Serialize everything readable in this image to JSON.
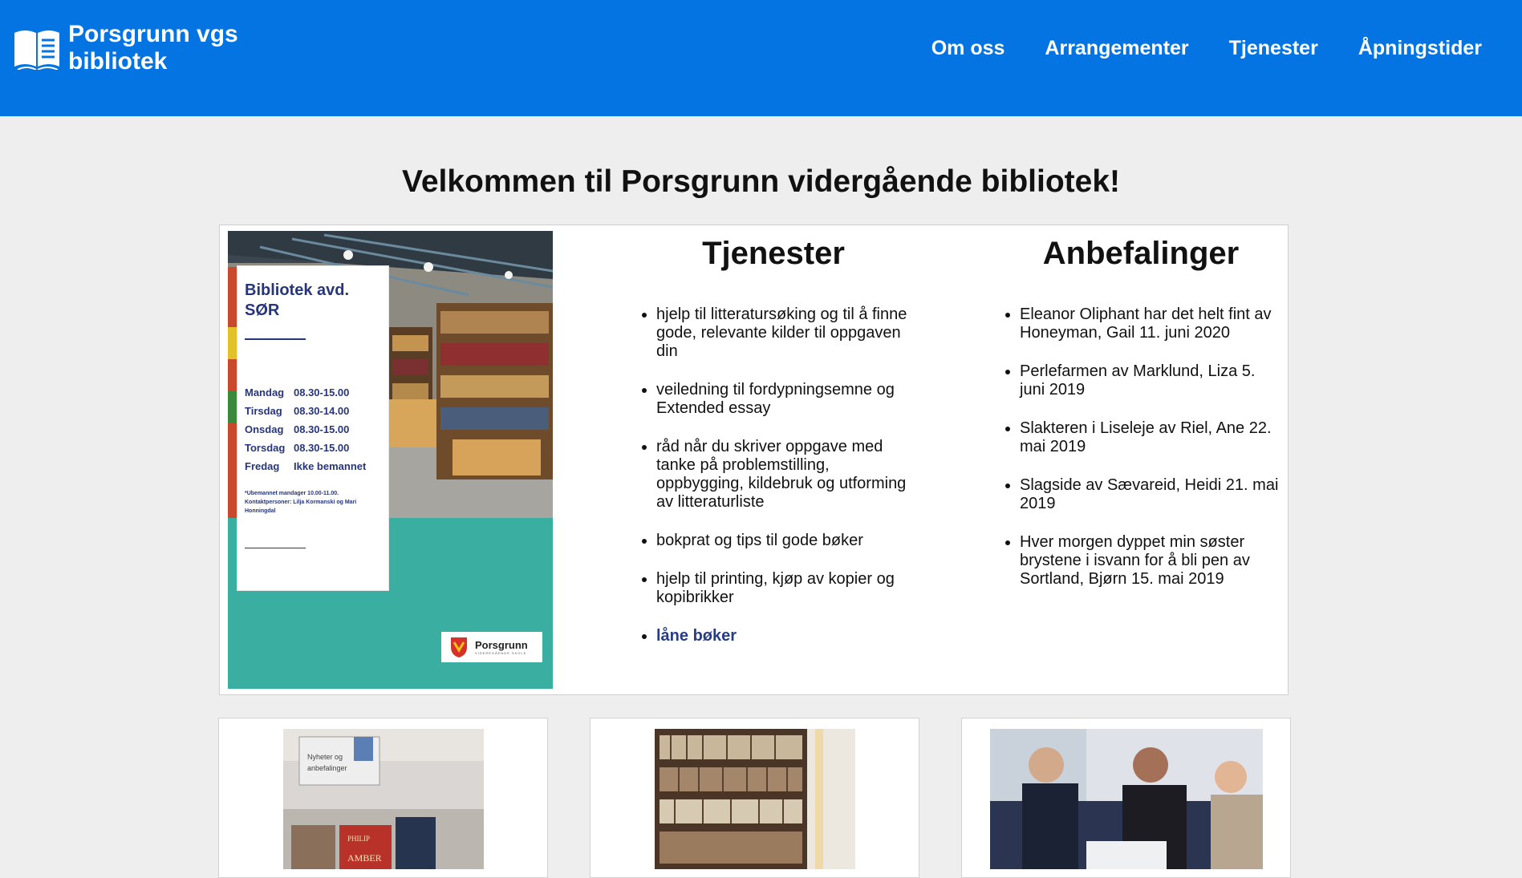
{
  "header": {
    "brand_line1": "Porsgrunn vgs",
    "brand_line2": "bibliotek",
    "brand_icon": "open-book-icon",
    "bg_color": "#0474e3",
    "nav": [
      {
        "label": "Om oss"
      },
      {
        "label": "Arrangementer"
      },
      {
        "label": "Tjenester"
      },
      {
        "label": "Åpningstider"
      }
    ]
  },
  "main": {
    "title": "Velkommen til Porsgrunn vidergående bibliotek!",
    "poster": {
      "title_line1": "Bibliotek avd.",
      "title_line2": "SØR",
      "hours": [
        {
          "day": "Mandag",
          "time": "08.30-15.00"
        },
        {
          "day": "Tirsdag",
          "time": "08.30-14.00"
        },
        {
          "day": "Onsdag",
          "time": "08.30-15.00"
        },
        {
          "day": "Torsdag",
          "time": "08.30-15.00"
        },
        {
          "day": "Fredag",
          "time": "Ikke bemannet"
        }
      ],
      "note": "*Ubemannet mandager 10.00-11.00. Kontaktpersoner: Lilja Kormanski og Mari Honningdal",
      "logo_name": "Porsgrunn",
      "logo_sub": "VIDEREGÅENDE SKOLE"
    },
    "tjenester": {
      "heading": "Tjenester",
      "items": [
        "hjelp til litteratursøking og til å finne gode, relevante kilder til oppgaven din",
        "veiledning til fordypningsemne og Extended essay",
        "råd når du skriver oppgave med tanke på problemstilling, oppbygging, kildebruk og utforming av litteraturliste",
        "bokprat og tips til gode bøker",
        "hjelp til printing, kjøp av kopier og kopibrikker"
      ],
      "link_item": "låne bøker"
    },
    "anbefalinger": {
      "heading": "Anbefalinger",
      "items": [
        "Eleanor Oliphant har det helt fint av Honeyman, Gail 11. juni 2020",
        "Perlefarmen av Marklund, Liza 5. juni 2019",
        "Slakteren i Liseleje av Riel, Ane 22. mai 2019",
        "Slagside av Sævareid, Heidi 21. mai 2019",
        "Hver morgen dyppet min søster brystene i isvann for å bli pen av Sortland, Bjørn 15. mai 2019"
      ]
    }
  },
  "tiles": [
    {
      "image": "new-books-display-photo",
      "sign_text": "Nyheter og anbefalinger"
    },
    {
      "image": "bookshelves-photo"
    },
    {
      "image": "students-studying-photo"
    }
  ]
}
